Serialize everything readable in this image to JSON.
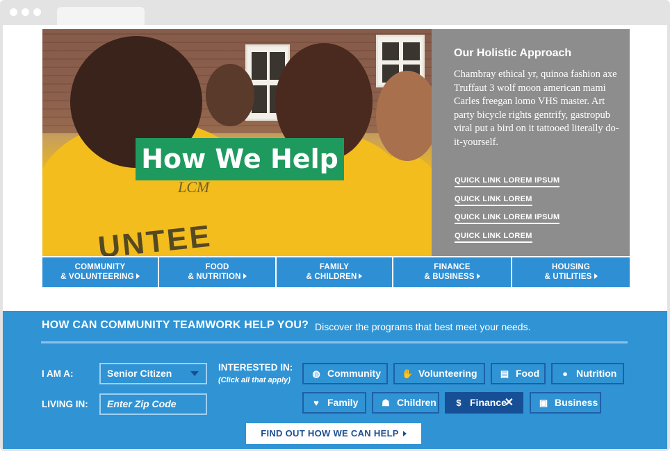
{
  "hero": {
    "title": "How We Help",
    "photo_logo": "LCM",
    "photo_word": "UNTEE"
  },
  "approach": {
    "title": "Our Holistic Approach",
    "body": "Chambray ethical yr, quinoa fashion axe Truffaut 3 wolf moon american mami Carles freegan lomo VHS master. Art party bicycle rights gentrify, gastropub viral put a bird on it tattooed literally do-it-yourself.",
    "quick_links": [
      "QUICK LINK LOREM IPSUM",
      "QUICK LINK LOREM",
      "QUICK LINK LOREM IPSUM",
      "QUICK LINK LOREM"
    ]
  },
  "categories": [
    {
      "line1": "Community",
      "line2": "& Volunteering"
    },
    {
      "line1": "Food",
      "line2": "& Nutrition"
    },
    {
      "line1": "Family",
      "line2": "& Children"
    },
    {
      "line1": "Finance",
      "line2": "& Business"
    },
    {
      "line1": "Housing",
      "line2": "& Utilities"
    }
  ],
  "finder": {
    "heading": "HOW CAN COMMUNITY TEAMWORK HELP YOU?",
    "subheading": "Discover the programs that best meet your needs.",
    "i_am_label": "I AM A:",
    "i_am_value": "Senior Citizen",
    "living_label": "LIVING IN:",
    "zip_placeholder": "Enter Zip Code",
    "interested_label": "INTERESTED IN:",
    "interested_hint": "(Click all that apply)",
    "chips": [
      {
        "label": "Community",
        "icon": "globe-icon",
        "selected": false
      },
      {
        "label": "Volunteering",
        "icon": "hand-icon",
        "selected": false
      },
      {
        "label": "Food",
        "icon": "basket-icon",
        "selected": false
      },
      {
        "label": "Nutrition",
        "icon": "apple-icon",
        "selected": false
      },
      {
        "label": "Family",
        "icon": "heart-icon",
        "selected": false
      },
      {
        "label": "Children",
        "icon": "children-icon",
        "selected": false
      },
      {
        "label": "Finance",
        "icon": "dollar-icon",
        "selected": true
      },
      {
        "label": "Business",
        "icon": "briefcase-icon",
        "selected": false
      }
    ],
    "cta": "FIND OUT HOW WE CAN HELP"
  },
  "colors": {
    "accent_blue": "#3093d4",
    "dark_blue": "#174f96",
    "green": "#1f9a5f",
    "panel_gray": "#8d8d8d"
  }
}
